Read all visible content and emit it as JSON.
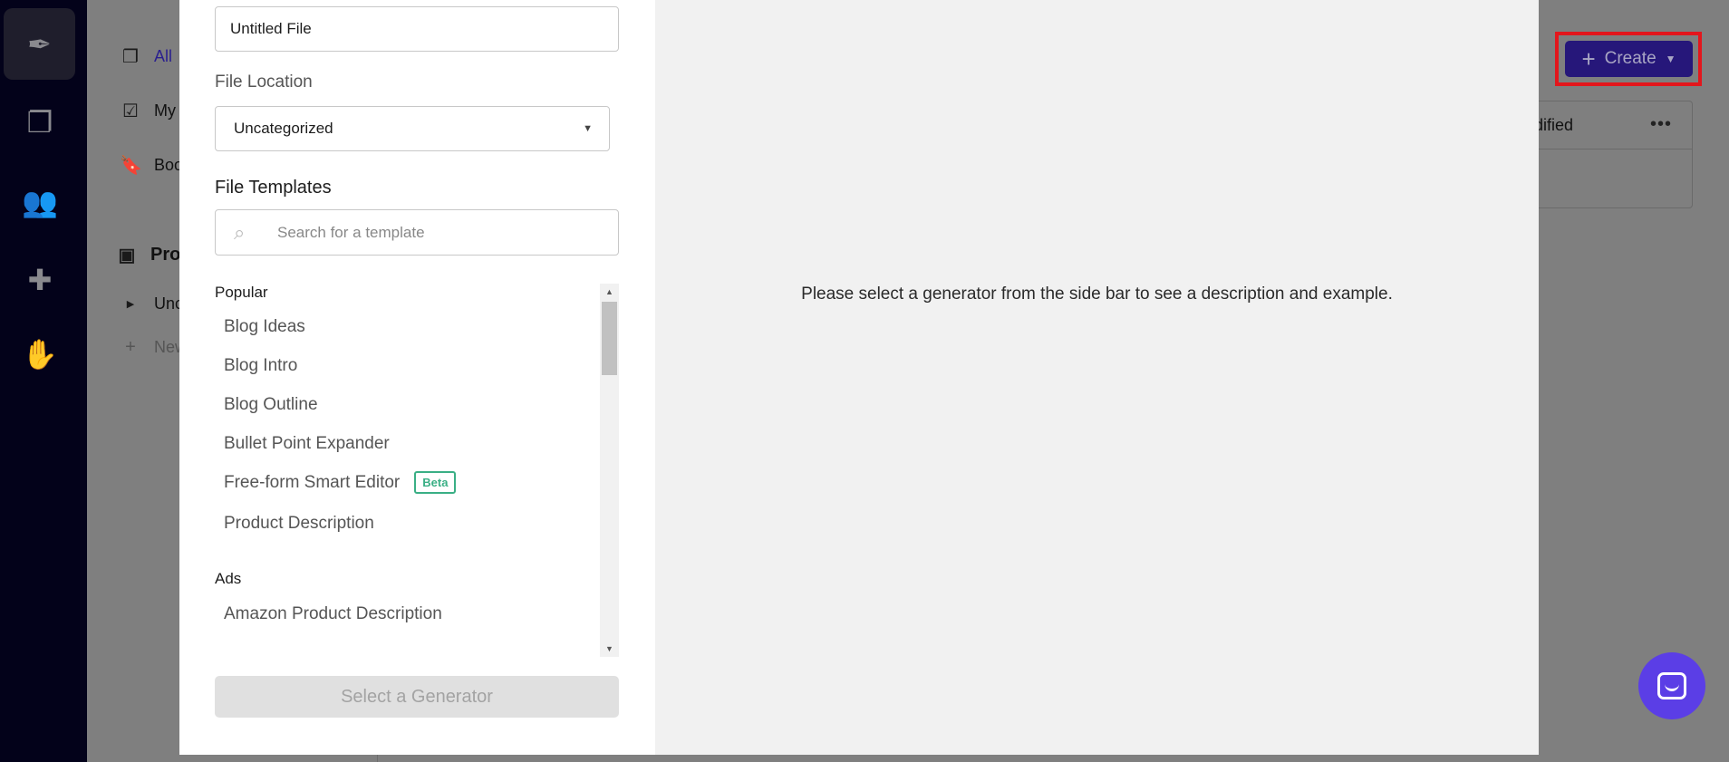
{
  "rail": {
    "icons": [
      "feather-sparkle-icon",
      "documents-icon",
      "users-icon",
      "puzzle-icon",
      "magic-hand-icon"
    ]
  },
  "background_nav": {
    "items": [
      {
        "label": "All",
        "icon": "documents-icon",
        "color": "#2a1f8f"
      },
      {
        "label": "My",
        "icon": "clipboard-check-icon"
      },
      {
        "label": "Boo",
        "icon": "bookmark-icon"
      }
    ],
    "projects_label": "Pro",
    "folder_label": "Unc",
    "new_label": "New"
  },
  "background_main": {
    "create_label": "Create",
    "column_header": "odified",
    "more_label": "•••"
  },
  "modal": {
    "file_name_value": "Untitled File",
    "file_location_label": "File Location",
    "file_location_value": "Uncategorized",
    "templates_label": "File Templates",
    "search_placeholder": "Search for a template",
    "groups": [
      {
        "label": "Popular",
        "items": [
          "Blog Ideas",
          "Blog Intro",
          "Blog Outline",
          "Bullet Point Expander",
          "Free-form Smart Editor",
          "Product Description"
        ]
      },
      {
        "label": "Ads",
        "items": [
          "Amazon Product Description"
        ]
      }
    ],
    "beta_badge": "Beta",
    "generator_button": "Select a Generator",
    "description_placeholder": "Please select a generator from the side bar to see a description and example."
  },
  "colors": {
    "brand": "#26177a",
    "highlight": "#e3161c",
    "beta": "#3aaf85",
    "chat": "#5b3ee6"
  }
}
